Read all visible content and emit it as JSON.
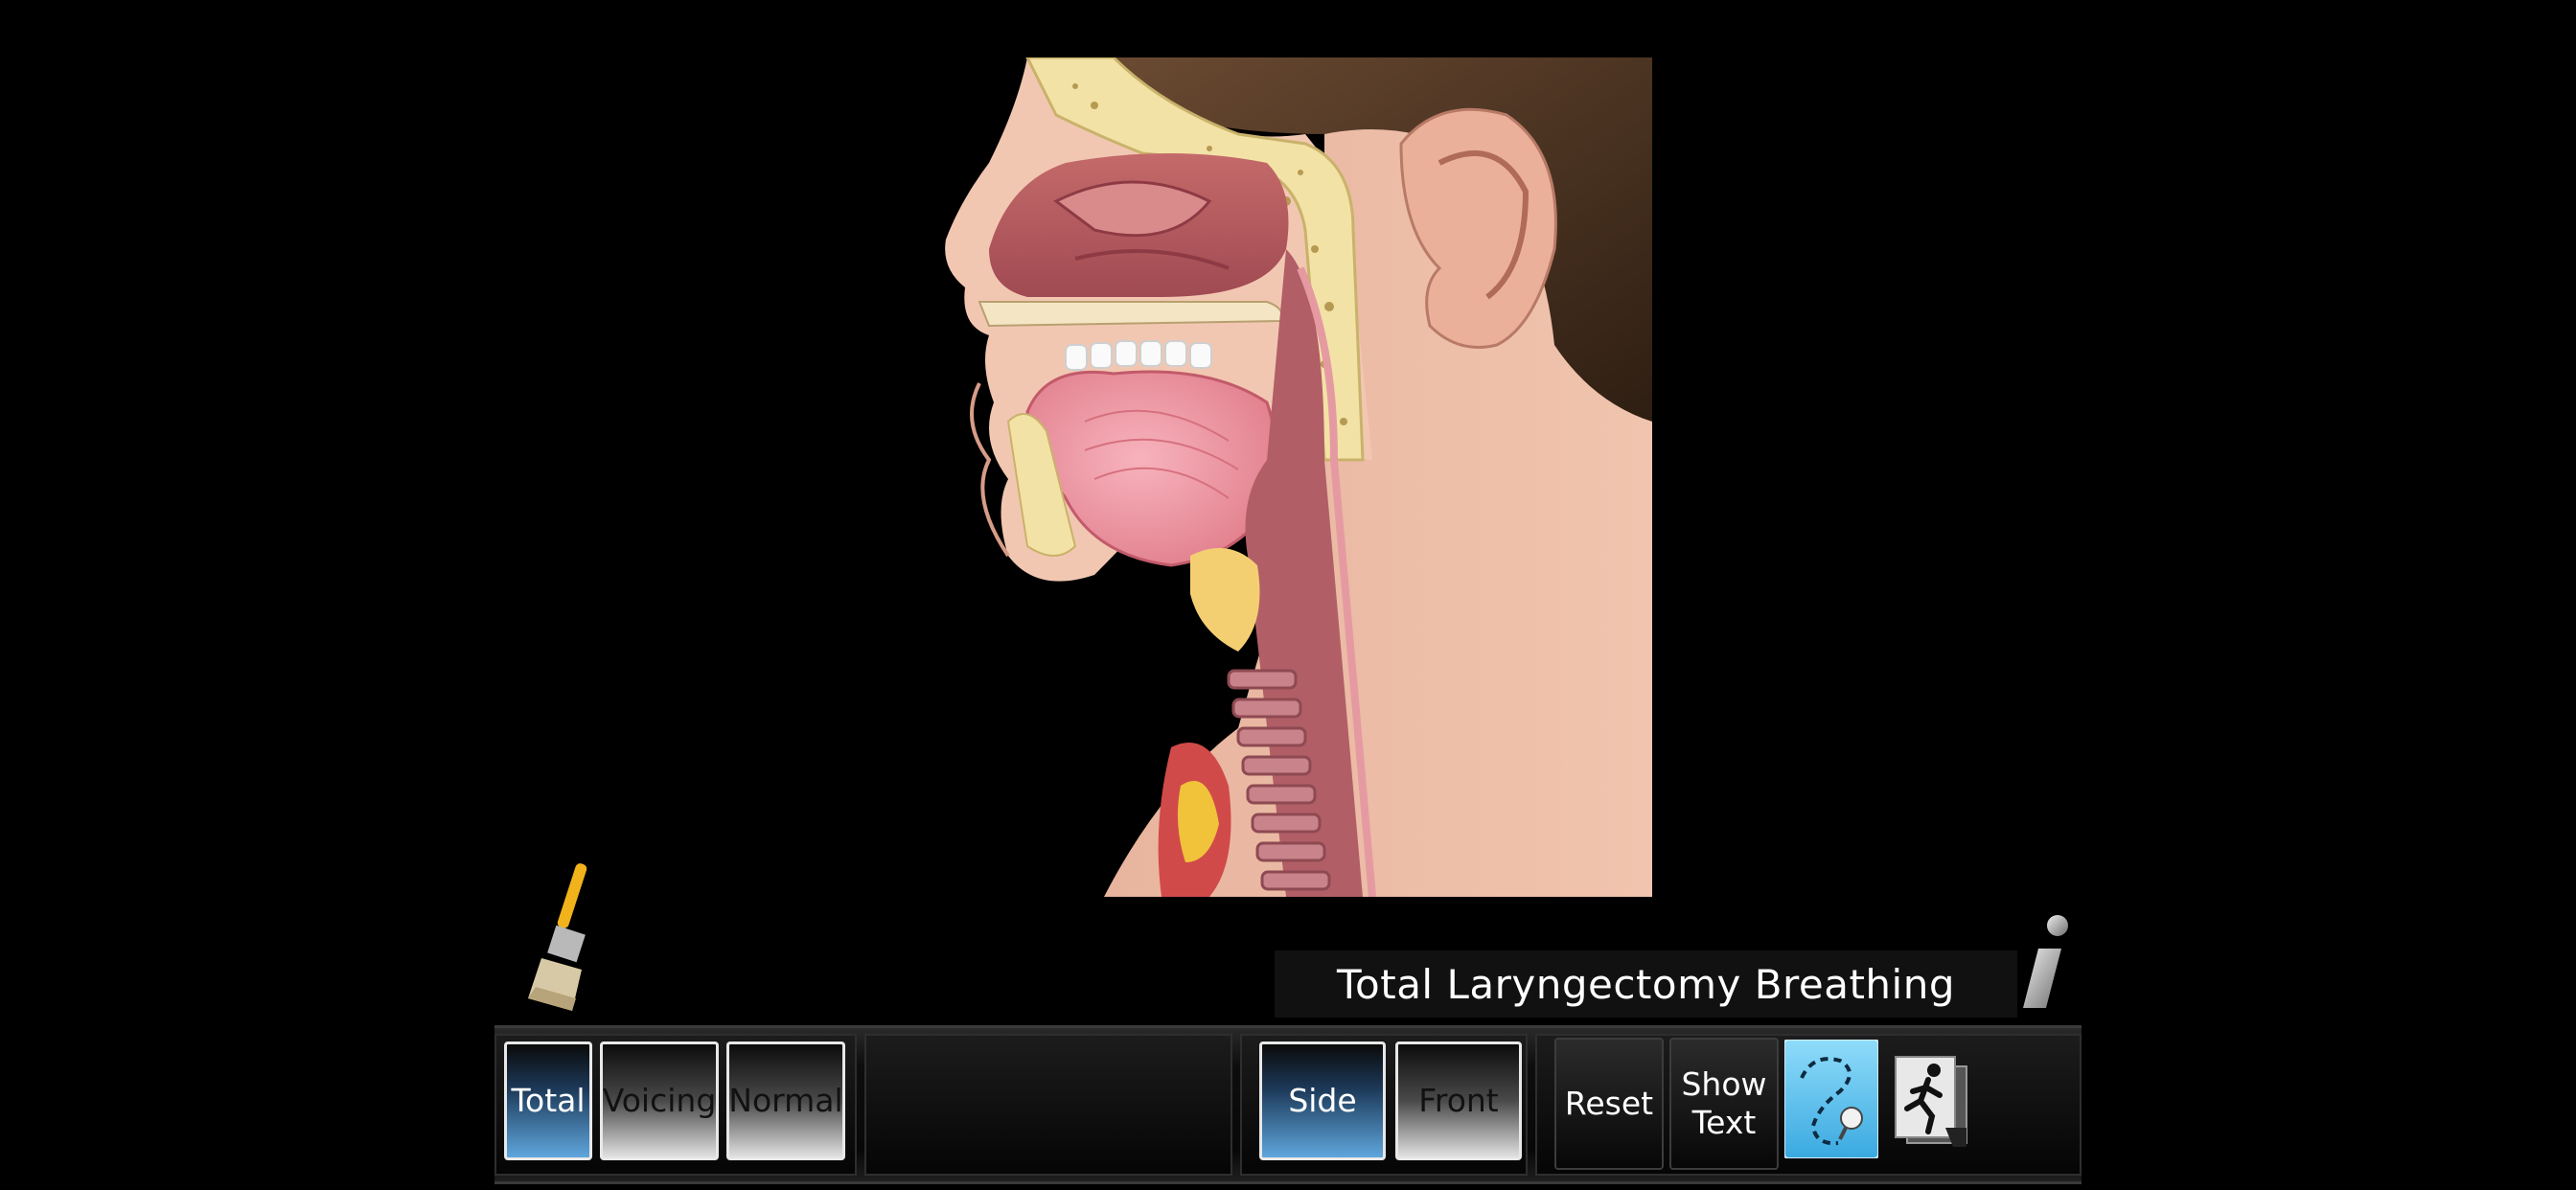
{
  "title": "Total Laryngectomy Breathing",
  "toolbar": {
    "total_label": "Total",
    "voicing_label": "Voicing",
    "normal_label": "Normal",
    "side_label": "Side",
    "front_label": "Front",
    "reset_label": "Reset",
    "show_text_line1": "Show",
    "show_text_line2": "Text"
  },
  "icons": {
    "paintbrush": "paintbrush-icon",
    "info": "info-icon",
    "path": "path-trace-icon",
    "exit": "exit-running-man-icon"
  },
  "colors": {
    "background": "#000000",
    "active_button": "#5fa6dc",
    "path_button": "#5bc3f0"
  }
}
